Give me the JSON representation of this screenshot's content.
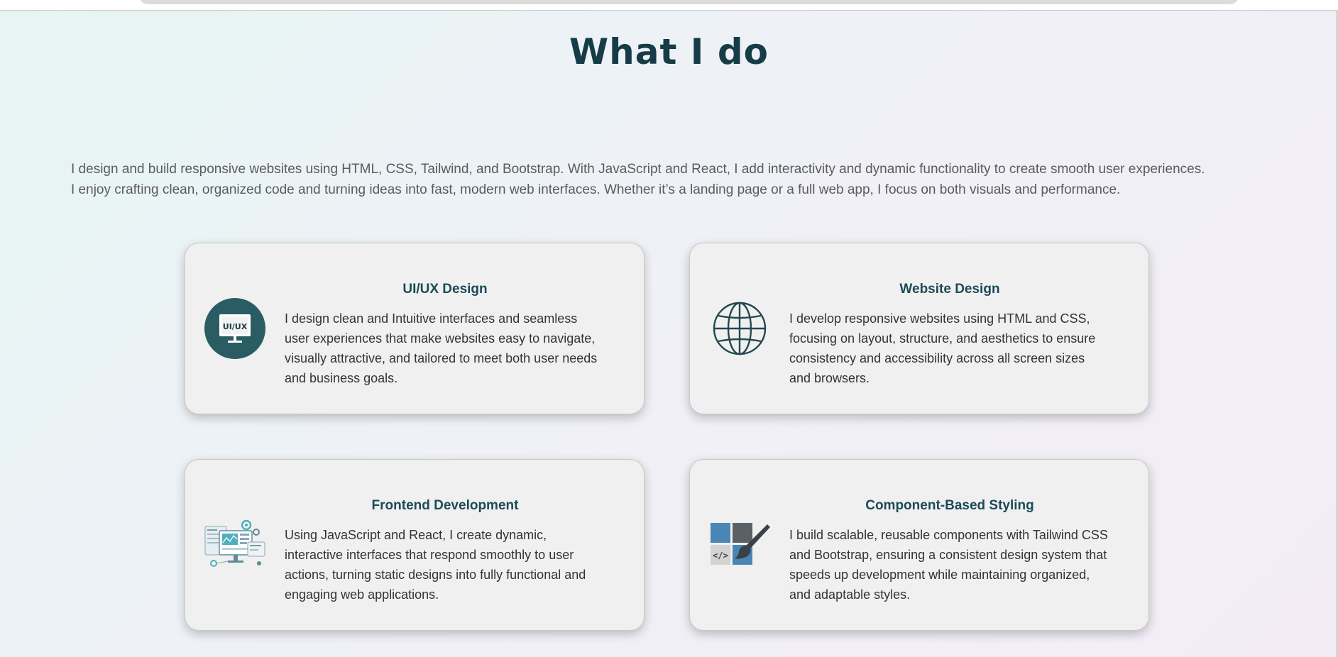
{
  "section": {
    "title": "What I do",
    "intro_lines": [
      "I design and build responsive websites using HTML, CSS, Tailwind, and Bootstrap. With JavaScript and React, I add interactivity and dynamic functionality to create smooth user experiences.",
      "I enjoy crafting clean, organized code and turning ideas into fast, modern web interfaces. Whether it’s a landing page or a full web app, I focus on both visuals and performance."
    ]
  },
  "services": [
    {
      "title": "UI/UX Design",
      "icon": "ui-ux-monitor-icon",
      "icon_label": "UI/UX",
      "lines": [
        "I design clean and Intuitive interfaces and seamless",
        "user experiences that make websites easy to navigate,",
        "visually attractive, and tailored to meet both user needs",
        "and business goals."
      ]
    },
    {
      "title": "Website Design",
      "icon": "globe-icon",
      "lines": [
        "I develop responsive websites using HTML and CSS,",
        "focusing on layout, structure, and aesthetics to ensure",
        "consistency and accessibility across all screen sizes",
        "and browsers."
      ]
    },
    {
      "title": "Frontend Development",
      "icon": "frontend-dashboard-icon",
      "lines": [
        "Using JavaScript and React, I create dynamic,",
        "interactive interfaces that respond smoothly to user",
        "actions, turning static designs into fully functional and",
        "engaging web applications."
      ]
    },
    {
      "title": "Component-Based Styling",
      "icon": "code-brush-icon",
      "icon_label": "</>",
      "lines": [
        "I build scalable, reusable components with Tailwind CSS",
        "and Bootstrap, ensuring a consistent design system that",
        "speeds up development while maintaining organized,",
        "and adaptable styles."
      ]
    }
  ],
  "colors": {
    "heading": "#163c48",
    "card_title": "#1d4a57",
    "icon_teal": "#2a5d63",
    "icon_blue": "#4a86b4"
  }
}
